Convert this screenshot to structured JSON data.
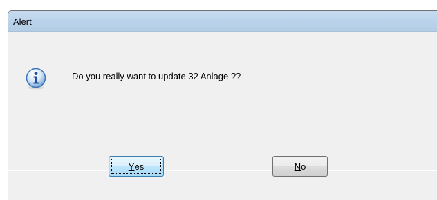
{
  "window": {
    "title": "Alert"
  },
  "dialog": {
    "icon": "information-icon",
    "message": "Do you really want to update 32 Anlage ??"
  },
  "buttons": {
    "yes": {
      "mnemonic": "Y",
      "rest": "es",
      "is_default": true
    },
    "no": {
      "mnemonic": "N",
      "rest": "o",
      "is_default": false
    }
  },
  "colors": {
    "titlebar": "#bcd4eb",
    "dialog_bg": "#f0f0f0",
    "icon_blue": "#2f6fc4"
  }
}
